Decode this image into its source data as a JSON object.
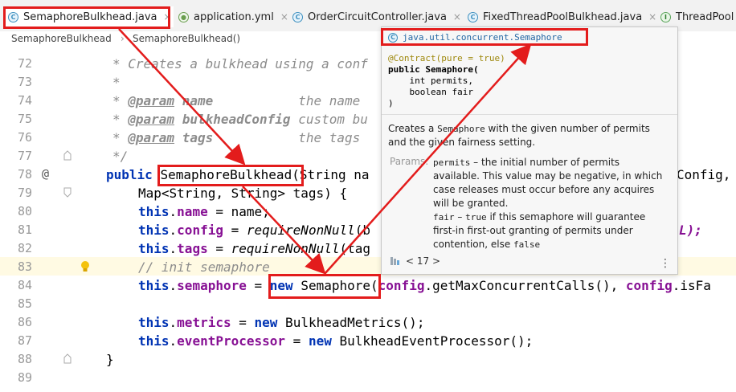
{
  "tabs": [
    {
      "label": "SemaphoreBulkhead.java",
      "icon": "class-icon",
      "active": true
    },
    {
      "label": "application.yml",
      "icon": "yaml-icon"
    },
    {
      "label": "OrderCircuitController.java",
      "icon": "class-icon"
    },
    {
      "label": "FixedThreadPoolBulkhead.java",
      "icon": "class-icon"
    },
    {
      "label": "ThreadPool",
      "icon": "interface-icon"
    }
  ],
  "tab_close": "×",
  "breadcrumb": [
    "SemaphoreBulkhead",
    "SemaphoreBulkhead()"
  ],
  "line_numbers": [
    "72",
    "73",
    "74",
    "75",
    "76",
    "77",
    "78",
    "79",
    "80",
    "81",
    "82",
    "83",
    "84",
    "85",
    "86",
    "87",
    "88",
    "89"
  ],
  "override_marker": "@",
  "code": {
    "l72": "* Creates a bulkhead using a conf",
    "l73": "*",
    "l74_tag": "@param",
    "l74_name": "name",
    "l74_desc": "the name",
    "l75_tag": "@param",
    "l75_name": "bulkheadConfig",
    "l75_desc": "custom bu",
    "l76_tag": "@param",
    "l76_name": "tags",
    "l76_desc": "the tags",
    "l77": "*/",
    "l78_kw": "public",
    "l78_name": "SemaphoreBulkhead",
    "l78_rest": "(String na",
    "l78_tail": "Config,",
    "l79": "Map<String, String> tags) {",
    "l80_kw": "this",
    "l80_fld": "name",
    "l80_rest": " = name;",
    "l81_kw": "this",
    "l81_fld": "config",
    "l81_eq": " = ",
    "l81_call": "requireNonNull",
    "l81_rest": "(b",
    "l81_tail": "L);",
    "l82_kw": "this",
    "l82_fld": "tags",
    "l82_eq": " = ",
    "l82_call": "requireNonNull",
    "l82_rest": "(tag",
    "l83": "// init semaphore",
    "l84_kw": "this",
    "l84_fld": "semaphore",
    "l84_eq": " = ",
    "l84_new": "new",
    "l84_cls": " Semaphore",
    "l84_arg1": "config",
    "l84_mid": ".getMaxConcurrentCalls(), ",
    "l84_arg2": "config",
    "l84_end": ".isFa",
    "l86_kw": "this",
    "l86_fld": "metrics",
    "l86_eq": " = ",
    "l86_new": "new",
    "l86_rest": " BulkheadMetrics();",
    "l87_kw": "this",
    "l87_fld": "eventProcessor",
    "l87_eq": " = ",
    "l87_new": "new",
    "l87_rest": " BulkheadEventProcessor();",
    "l88": "}"
  },
  "popup": {
    "header": "java.util.concurrent.Semaphore",
    "annotation": "@Contract(pure = true)",
    "sig1": "public Semaphore(",
    "sig2": "    int permits,",
    "sig3": "    boolean fair",
    "sig4": ")",
    "desc_pre": "Creates a ",
    "desc_code": "Semaphore",
    "desc_post": " with the given number of permits and the given fairness setting.",
    "params_label": "Params:",
    "p1_name": "permits",
    "p1_desc": " – the initial number of permits available. This value may be negative, in which case releases must occur before any acquires will be granted.",
    "p2_name": "fair",
    "p2_mid": " – ",
    "p2_true": "true",
    "p2_desc": " if this semaphore will guarantee first-in first-out granting of permits under contention, else ",
    "p2_false": "false",
    "nav": "< 17 >",
    "more": "⋮"
  },
  "colors": {
    "annotation_red": "#e31c1c",
    "keyword": "#0033b3",
    "field": "#871094"
  }
}
